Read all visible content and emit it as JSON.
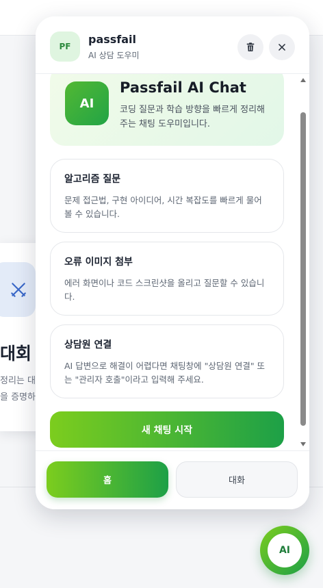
{
  "background": {
    "card_title": "대회",
    "card_line_1": "정리는 대",
    "card_line_2": "을 증명하"
  },
  "header": {
    "avatar_text": "PF",
    "title": "passfail",
    "subtitle": "AI 상담 도우미",
    "trash_icon": "trash-icon",
    "close_icon": "close-icon"
  },
  "hero": {
    "badge": "AI",
    "title": "Passfail AI Chat",
    "description": "코딩 질문과 학습 방향을 빠르게 정리해 주는 채팅 도우미입니다."
  },
  "cards": [
    {
      "title": "알고리즘 질문",
      "description": "문제 접근법, 구현 아이디어, 시간 복잡도를 빠르게 물어볼 수 있습니다."
    },
    {
      "title": "오류 이미지 첨부",
      "description": "에러 화면이나 코드 스크린샷을 올리고 질문할 수 있습니다."
    },
    {
      "title": "상담원 연결",
      "description": "AI 답변으로 해결이 어렵다면 채팅창에 \"상담원 연결\" 또는 \"관리자 호출\"이라고 입력해 주세요."
    }
  ],
  "cta_label": "새 채팅 시작",
  "nav": {
    "home_label": "홈",
    "chat_label": "대화"
  },
  "fab_label": "AI",
  "colors": {
    "accent_start": "#7ccd1e",
    "accent_end": "#1da047"
  }
}
